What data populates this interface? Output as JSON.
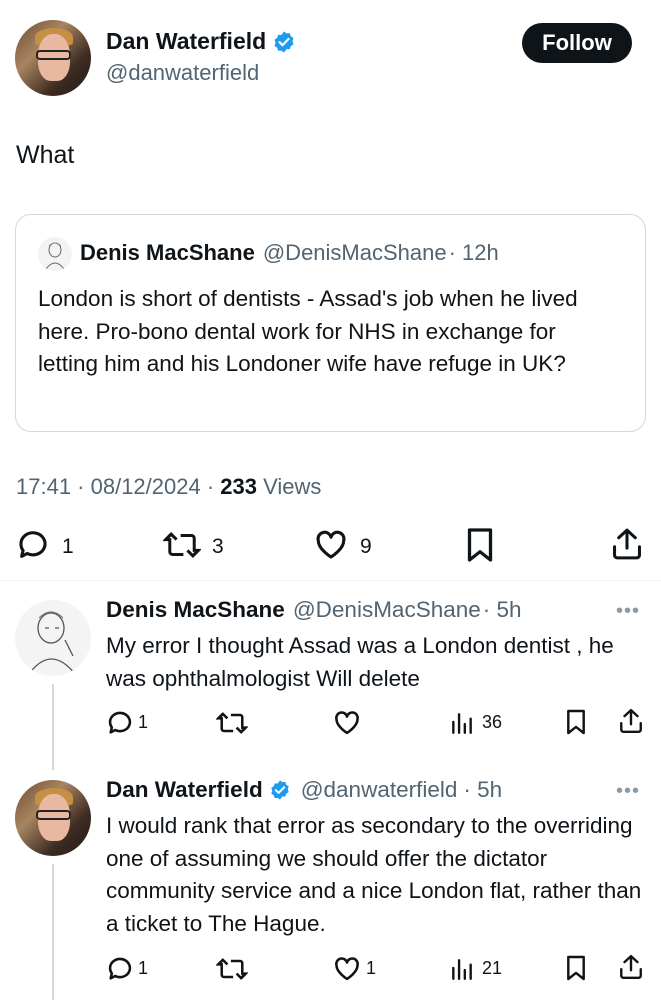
{
  "main_tweet": {
    "author_name": "Dan Waterfield",
    "author_handle": "@danwaterfield",
    "follow_label": "Follow",
    "text": "What",
    "timestamp": "17:41 · 08/12/2024 · ",
    "views_count": "233",
    "views_label": "Views",
    "actions": {
      "replies": "1",
      "reposts": "3",
      "likes": "9"
    }
  },
  "quoted_tweet": {
    "author_name": "Denis MacShane",
    "author_handle": "@DenisMacShane",
    "time": "· 12h",
    "text": "London is short of dentists - Assad's job when he lived here. Pro-bono dental work for NHS in exchange for letting him and his Londoner wife have refuge in UK?"
  },
  "replies": [
    {
      "author_name": "Denis MacShane",
      "author_handle": "@DenisMacShane",
      "time": "· 5h",
      "text": "My error I thought Assad was a London dentist , he was ophthalmologist Will delete",
      "replies": "1",
      "reposts": "",
      "likes": "",
      "views": "36"
    },
    {
      "author_name": "Dan Waterfield",
      "author_handle": "@danwaterfield",
      "time": "· 5h",
      "text": "I would rank that error as secondary to the overriding one of assuming we should offer the dictator community service and a nice London flat, rather than a ticket to The Hague.",
      "replies": "1",
      "reposts": "",
      "likes": "1",
      "views": "21"
    }
  ],
  "colors": {
    "verified": "#1d9bf0",
    "text": "#0f1419",
    "muted": "#536471"
  }
}
